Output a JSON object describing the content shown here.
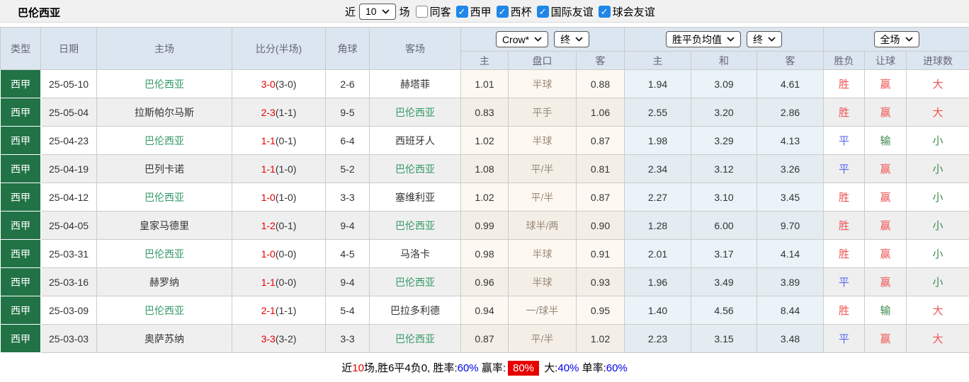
{
  "title": "巴伦西亚",
  "filter_bar": {
    "recent_label": "近",
    "recent_count": "10",
    "matches_label": "场",
    "checkboxes": [
      {
        "label": "同客",
        "checked": false
      },
      {
        "label": "西甲",
        "checked": true
      },
      {
        "label": "西杯",
        "checked": true
      },
      {
        "label": "国际友谊",
        "checked": true
      },
      {
        "label": "球会友谊",
        "checked": true
      }
    ]
  },
  "table_header": {
    "left_columns": [
      "类型",
      "日期",
      "主场",
      "比分(半场)",
      "角球",
      "客场"
    ],
    "handicap_group": {
      "company_select": "Crow*",
      "state_select": "终",
      "subcols": [
        "主",
        "盘口",
        "客"
      ]
    },
    "odds_group": {
      "type_select": "胜平负均值",
      "state_select": "终",
      "subcols": [
        "主",
        "和",
        "客"
      ]
    },
    "result_group": {
      "period_select": "全场",
      "subcols": [
        "胜负",
        "让球",
        "进球数"
      ]
    }
  },
  "rows": [
    {
      "type": "西甲",
      "date": "25-05-10",
      "home": "巴伦西亚",
      "home_is_focus": true,
      "score": "3-0",
      "half": "(3-0)",
      "corners": "2-6",
      "away": "赫塔菲",
      "away_is_focus": false,
      "ah_home": "1.01",
      "ah_line": "半球",
      "ah_away": "0.88",
      "op_home": "1.94",
      "op_draw": "3.09",
      "op_away": "4.61",
      "res_wdl": "胜",
      "res_wdl_color": "red",
      "res_ah": "赢",
      "res_ah_color": "red",
      "res_goal": "大",
      "res_goal_color": "red"
    },
    {
      "type": "西甲",
      "date": "25-05-04",
      "home": "拉斯帕尔马斯",
      "home_is_focus": false,
      "score": "2-3",
      "half": "(1-1)",
      "corners": "9-5",
      "away": "巴伦西亚",
      "away_is_focus": true,
      "ah_home": "0.83",
      "ah_line": "平手",
      "ah_away": "1.06",
      "op_home": "2.55",
      "op_draw": "3.20",
      "op_away": "2.86",
      "res_wdl": "胜",
      "res_wdl_color": "red",
      "res_ah": "赢",
      "res_ah_color": "red",
      "res_goal": "大",
      "res_goal_color": "red"
    },
    {
      "type": "西甲",
      "date": "25-04-23",
      "home": "巴伦西亚",
      "home_is_focus": true,
      "score": "1-1",
      "half": "(0-1)",
      "corners": "6-4",
      "away": "西班牙人",
      "away_is_focus": false,
      "ah_home": "1.02",
      "ah_line": "半球",
      "ah_away": "0.87",
      "op_home": "1.98",
      "op_draw": "3.29",
      "op_away": "4.13",
      "res_wdl": "平",
      "res_wdl_color": "blue",
      "res_ah": "输",
      "res_ah_color": "green",
      "res_goal": "小",
      "res_goal_color": "green"
    },
    {
      "type": "西甲",
      "date": "25-04-19",
      "home": "巴列卡诺",
      "home_is_focus": false,
      "score": "1-1",
      "half": "(1-0)",
      "corners": "5-2",
      "away": "巴伦西亚",
      "away_is_focus": true,
      "ah_home": "1.08",
      "ah_line": "平/半",
      "ah_away": "0.81",
      "op_home": "2.34",
      "op_draw": "3.12",
      "op_away": "3.26",
      "res_wdl": "平",
      "res_wdl_color": "blue",
      "res_ah": "赢",
      "res_ah_color": "red",
      "res_goal": "小",
      "res_goal_color": "green"
    },
    {
      "type": "西甲",
      "date": "25-04-12",
      "home": "巴伦西亚",
      "home_is_focus": true,
      "score": "1-0",
      "half": "(1-0)",
      "corners": "3-3",
      "away": "塞维利亚",
      "away_is_focus": false,
      "ah_home": "1.02",
      "ah_line": "平/半",
      "ah_away": "0.87",
      "op_home": "2.27",
      "op_draw": "3.10",
      "op_away": "3.45",
      "res_wdl": "胜",
      "res_wdl_color": "red",
      "res_ah": "赢",
      "res_ah_color": "red",
      "res_goal": "小",
      "res_goal_color": "green"
    },
    {
      "type": "西甲",
      "date": "25-04-05",
      "home": "皇家马德里",
      "home_is_focus": false,
      "score": "1-2",
      "half": "(0-1)",
      "corners": "9-4",
      "away": "巴伦西亚",
      "away_is_focus": true,
      "ah_home": "0.99",
      "ah_line": "球半/两",
      "ah_away": "0.90",
      "op_home": "1.28",
      "op_draw": "6.00",
      "op_away": "9.70",
      "res_wdl": "胜",
      "res_wdl_color": "red",
      "res_ah": "赢",
      "res_ah_color": "red",
      "res_goal": "小",
      "res_goal_color": "green"
    },
    {
      "type": "西甲",
      "date": "25-03-31",
      "home": "巴伦西亚",
      "home_is_focus": true,
      "score": "1-0",
      "half": "(0-0)",
      "corners": "4-5",
      "away": "马洛卡",
      "away_is_focus": false,
      "ah_home": "0.98",
      "ah_line": "半球",
      "ah_away": "0.91",
      "op_home": "2.01",
      "op_draw": "3.17",
      "op_away": "4.14",
      "res_wdl": "胜",
      "res_wdl_color": "red",
      "res_ah": "赢",
      "res_ah_color": "red",
      "res_goal": "小",
      "res_goal_color": "green"
    },
    {
      "type": "西甲",
      "date": "25-03-16",
      "home": "赫罗纳",
      "home_is_focus": false,
      "score": "1-1",
      "half": "(0-0)",
      "corners": "9-4",
      "away": "巴伦西亚",
      "away_is_focus": true,
      "ah_home": "0.96",
      "ah_line": "半球",
      "ah_away": "0.93",
      "op_home": "1.96",
      "op_draw": "3.49",
      "op_away": "3.89",
      "res_wdl": "平",
      "res_wdl_color": "blue",
      "res_ah": "赢",
      "res_ah_color": "red",
      "res_goal": "小",
      "res_goal_color": "green"
    },
    {
      "type": "西甲",
      "date": "25-03-09",
      "home": "巴伦西亚",
      "home_is_focus": true,
      "score": "2-1",
      "half": "(1-1)",
      "corners": "5-4",
      "away": "巴拉多利德",
      "away_is_focus": false,
      "ah_home": "0.94",
      "ah_line": "一/球半",
      "ah_away": "0.95",
      "op_home": "1.40",
      "op_draw": "4.56",
      "op_away": "8.44",
      "res_wdl": "胜",
      "res_wdl_color": "red",
      "res_ah": "输",
      "res_ah_color": "green",
      "res_goal": "大",
      "res_goal_color": "red"
    },
    {
      "type": "西甲",
      "date": "25-03-03",
      "home": "奥萨苏纳",
      "home_is_focus": false,
      "score": "3-3",
      "half": "(3-2)",
      "corners": "3-3",
      "away": "巴伦西亚",
      "away_is_focus": true,
      "ah_home": "0.87",
      "ah_line": "平/半",
      "ah_away": "1.02",
      "op_home": "2.23",
      "op_draw": "3.15",
      "op_away": "3.48",
      "res_wdl": "平",
      "res_wdl_color": "blue",
      "res_ah": "赢",
      "res_ah_color": "red",
      "res_goal": "大",
      "res_goal_color": "red"
    }
  ],
  "summary": {
    "segments": [
      {
        "text": "近",
        "style": "plain"
      },
      {
        "text": "10",
        "style": "red"
      },
      {
        "text": "场,胜6平4负0, 胜率:",
        "style": "plain"
      },
      {
        "text": "60%",
        "style": "blue"
      },
      {
        "text": " 赢率:",
        "style": "plain"
      },
      {
        "text": "80%",
        "style": "badge"
      },
      {
        "text": " 大:",
        "style": "plain"
      },
      {
        "text": "40%",
        "style": "blue"
      },
      {
        "text": " 单率:",
        "style": "plain"
      },
      {
        "text": "60%",
        "style": "blue"
      }
    ]
  },
  "colors": {
    "type_cell_green": "#217346",
    "focus_team_green": "#339966",
    "score_red": "#e60000",
    "result_red": "#f05555",
    "result_blue": "#5b6af0",
    "result_green": "#3e8c4f",
    "percent_blue": "#0000ee",
    "badge_red": "#e60000",
    "checkbox_blue": "#1f87e8",
    "header_bg": "#dce6f0",
    "handicap_col_bg": "#fdf9f2",
    "odds_col_bg": "#e9f3f8"
  }
}
